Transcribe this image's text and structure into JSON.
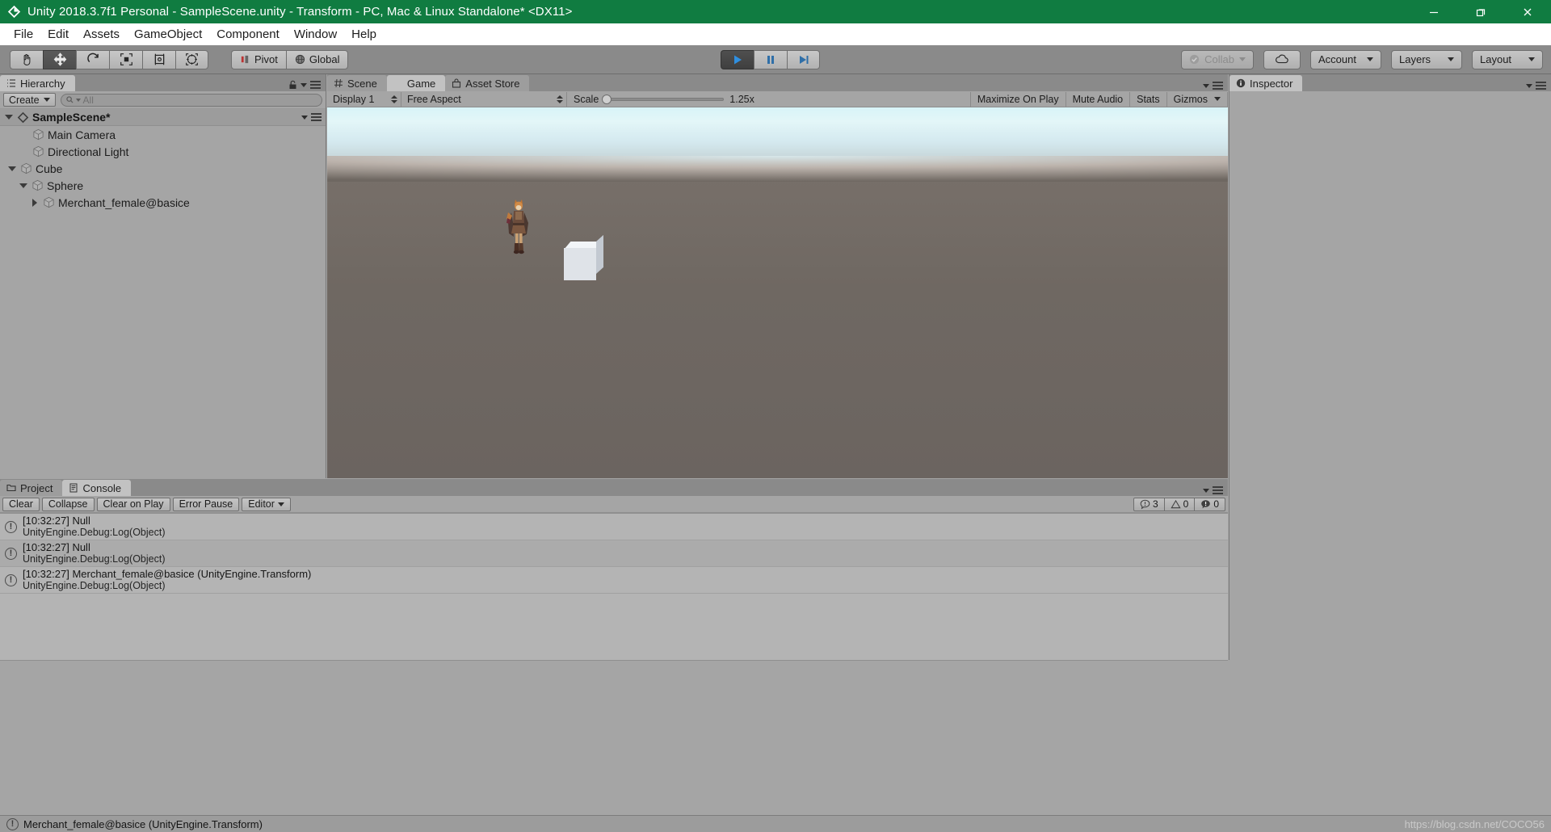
{
  "window": {
    "title": "Unity 2018.3.7f1 Personal - SampleScene.unity - Transform - PC, Mac & Linux Standalone* <DX11>",
    "minimize_label": "—",
    "restore_label": "❐",
    "close_label": "✕"
  },
  "menu": {
    "items": [
      {
        "label": "File"
      },
      {
        "label": "Edit"
      },
      {
        "label": "Assets"
      },
      {
        "label": "GameObject"
      },
      {
        "label": "Component"
      },
      {
        "label": "Window"
      },
      {
        "label": "Help"
      }
    ]
  },
  "toolbar": {
    "tools": [
      {
        "name": "hand-tool",
        "icon": "hand-icon",
        "active": false
      },
      {
        "name": "move-tool",
        "icon": "move-icon",
        "active": true
      },
      {
        "name": "rotate-tool",
        "icon": "rotate-icon",
        "active": false
      },
      {
        "name": "scale-tool",
        "icon": "scale-icon",
        "active": false
      },
      {
        "name": "rect-tool",
        "icon": "rect-icon",
        "active": false
      },
      {
        "name": "transform-tool",
        "icon": "transform-icon",
        "active": false
      }
    ],
    "pivot_label": "Pivot",
    "global_label": "Global",
    "play_label": "▶",
    "pause_label": "❙❙",
    "step_label": "▶|",
    "collab_label": "Collab",
    "cloud_label": "cloud-icon",
    "account_label": "Account",
    "layers_label": "Layers",
    "layout_label": "Layout"
  },
  "hierarchy": {
    "tab_label": "Hierarchy",
    "create_label": "Create",
    "search_placeholder": "All",
    "scene_label": "SampleScene*",
    "items": [
      {
        "label": "Main Camera",
        "depth": 1,
        "twisty": "none"
      },
      {
        "label": "Directional Light",
        "depth": 1,
        "twisty": "none"
      },
      {
        "label": "Cube",
        "depth": 1,
        "twisty": "down"
      },
      {
        "label": "Sphere",
        "depth": 2,
        "twisty": "down"
      },
      {
        "label": "Merchant_female@basice",
        "depth": 3,
        "twisty": "right"
      }
    ]
  },
  "gameview": {
    "tabs": [
      {
        "label": "Scene",
        "icon": "grid-icon",
        "active": false
      },
      {
        "label": "Game",
        "icon": "gamepad-icon",
        "active": true
      },
      {
        "label": "Asset Store",
        "icon": "store-icon",
        "active": false
      }
    ],
    "display_label": "Display 1",
    "aspect_label": "Free Aspect",
    "scale_label": "Scale",
    "scale_value": "1.25x",
    "maximize_label": "Maximize On Play",
    "mute_label": "Mute Audio",
    "stats_label": "Stats",
    "gizmos_label": "Gizmos"
  },
  "inspector": {
    "tab_label": "Inspector"
  },
  "console": {
    "tabs": [
      {
        "label": "Project",
        "icon": "folder-icon",
        "active": false
      },
      {
        "label": "Console",
        "icon": "console-icon",
        "active": true
      }
    ],
    "clear_label": "Clear",
    "collapse_label": "Collapse",
    "clear_on_play_label": "Clear on Play",
    "error_pause_label": "Error Pause",
    "editor_label": "Editor",
    "counts": {
      "info": "3",
      "warning": "0",
      "error": "0"
    },
    "entries": [
      {
        "message": "[10:32:27] Null",
        "stack": "UnityEngine.Debug:Log(Object)"
      },
      {
        "message": "[10:32:27] Null",
        "stack": "UnityEngine.Debug:Log(Object)"
      },
      {
        "message": "[10:32:27] Merchant_female@basice (UnityEngine.Transform)",
        "stack": "UnityEngine.Debug:Log(Object)"
      }
    ]
  },
  "statusbar": {
    "message": "Merchant_female@basice (UnityEngine.Transform)",
    "watermark": "https://blog.csdn.net/COCO56"
  },
  "colors": {
    "titlebar": "#107c41",
    "panel": "#a5a5a5",
    "toolbar": "#8a8a8a",
    "play_accent": "#2f8fe0"
  }
}
